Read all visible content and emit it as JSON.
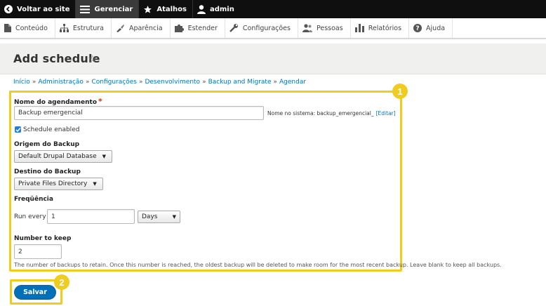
{
  "toolbar": {
    "back_label": "Voltar ao site",
    "manage_label": "Gerenciar",
    "shortcuts_label": "Atalhos",
    "user_label": "admin"
  },
  "menu": {
    "items": [
      {
        "label": "Conteúdo",
        "icon": "file-icon"
      },
      {
        "label": "Estrutura",
        "icon": "sitemap-icon"
      },
      {
        "label": "Aparência",
        "icon": "brush-icon"
      },
      {
        "label": "Estender",
        "icon": "puzzle-icon"
      },
      {
        "label": "Configurações",
        "icon": "wrench-icon"
      },
      {
        "label": "Pessoas",
        "icon": "people-icon"
      },
      {
        "label": "Relatórios",
        "icon": "bar-chart-icon"
      },
      {
        "label": "Ajuda",
        "icon": "help-icon"
      }
    ]
  },
  "page": {
    "title": "Add schedule",
    "star": "☆"
  },
  "breadcrumb": {
    "items": [
      "Início",
      "Administração",
      "Configurações",
      "Desenvolvimento",
      "Backup and Migrate",
      "Agendar"
    ],
    "separator": "»"
  },
  "form": {
    "name_label": "Nome do agendamento",
    "required_mark": "*",
    "name_value": "Backup emergencial",
    "machine_name_text": "Nome no sistema: backup_emergencial_",
    "machine_name_edit": "[Editar]",
    "enabled_label": "Schedule enabled",
    "enabled_checked": true,
    "source_label": "Origem do Backup",
    "source_value": "Default Drupal Database",
    "destination_label": "Destino do Backup",
    "destination_value": "Private Files Directory",
    "frequency_label": "Freqüência",
    "run_every_label": "Run every",
    "run_every_value": "1",
    "period_value": "Days",
    "keep_label": "Number to keep",
    "keep_value": "2",
    "keep_description": "The number of backups to retain. Once this number is reached, the oldest backup will be deleted to make room for the most recent backup. Leave blank to keep all backups.",
    "save_label": "Salvar"
  },
  "annotations": {
    "badge_1": "1",
    "badge_2": "2",
    "highlight_color": "#f0cc1e"
  },
  "colors": {
    "link": "#0074bd",
    "primary_button": "#0071b8",
    "toolbar_bg": "#0f0f0f"
  }
}
